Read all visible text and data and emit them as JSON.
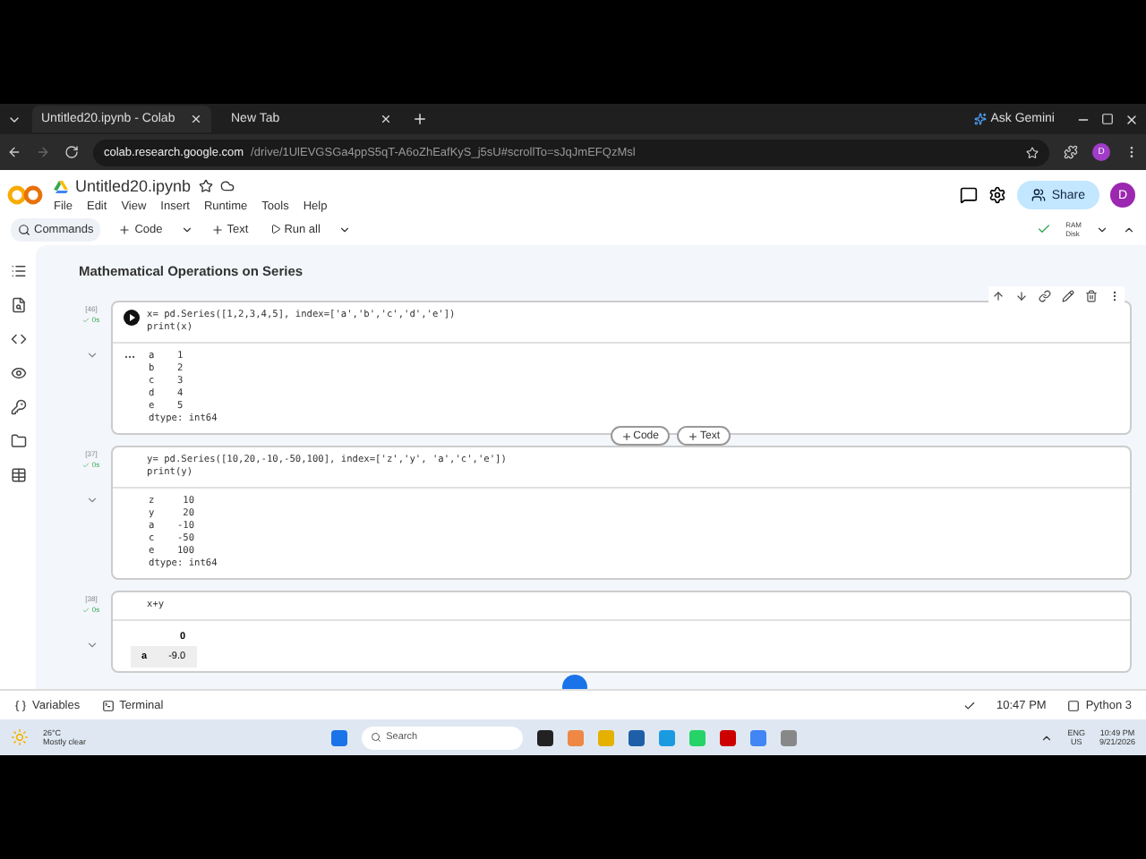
{
  "browser": {
    "tabs": [
      {
        "title": "Untitled20.ipynb - Colab",
        "selected": true
      },
      {
        "title": "New Tab",
        "selected": false
      }
    ],
    "ask_gemini": "Ask Gemini",
    "url_host": "colab.research.google.com",
    "url_path": "/drive/1UlEVGSGa4ppS5qT-A6oZhEafKyS_j5sU#scrollTo=sJqJmEFQzMsl",
    "profile": "D"
  },
  "colab": {
    "title": "Untitled20.ipynb",
    "menu": [
      "File",
      "Edit",
      "View",
      "Insert",
      "Runtime",
      "Tools",
      "Help"
    ],
    "commands": "Commands",
    "add_code": "Code",
    "add_text": "Text",
    "run_all": "Run all",
    "share": "Share",
    "avatar": "D",
    "ram": "RAM",
    "disk": "Disk"
  },
  "notebook": {
    "heading": "Mathematical Operations on Series",
    "insert_code": "Code",
    "insert_text": "Text",
    "cells": [
      {
        "kind": "print",
        "count": "[46]",
        "time": "0s",
        "code": [
          "x= pd.Series([1,2,3,4,5], index=['a','b','c','d','e'])",
          "print(x)"
        ],
        "output": [
          "a    1",
          "b    2",
          "c    3",
          "d    4",
          "e    5",
          "dtype: int64"
        ]
      },
      {
        "kind": "print",
        "count": "[37]",
        "time": "0s",
        "code": [
          "y= pd.Series([10,20,-10,-50,100], index=['z','y', 'a','c','e'])",
          "print(y)"
        ],
        "output": [
          "z     10",
          "y     20",
          "a    -10",
          "c    -50",
          "e    100",
          "dtype: int64"
        ]
      },
      {
        "kind": "table",
        "count": "[38]",
        "time": "0s",
        "code": [
          "x+y"
        ],
        "header": "0",
        "rows": [
          [
            "a",
            "-9.0"
          ]
        ]
      }
    ]
  },
  "status": {
    "variables": "Variables",
    "terminal": "Terminal",
    "time": "10:47 PM",
    "runtime": "Python 3"
  },
  "taskbar": {
    "temp": "26°C",
    "weather": "Mostly clear",
    "search": "Search",
    "lang": "ENG",
    "region": "US",
    "clock": "10:49 PM",
    "date": "9/21/2026"
  }
}
